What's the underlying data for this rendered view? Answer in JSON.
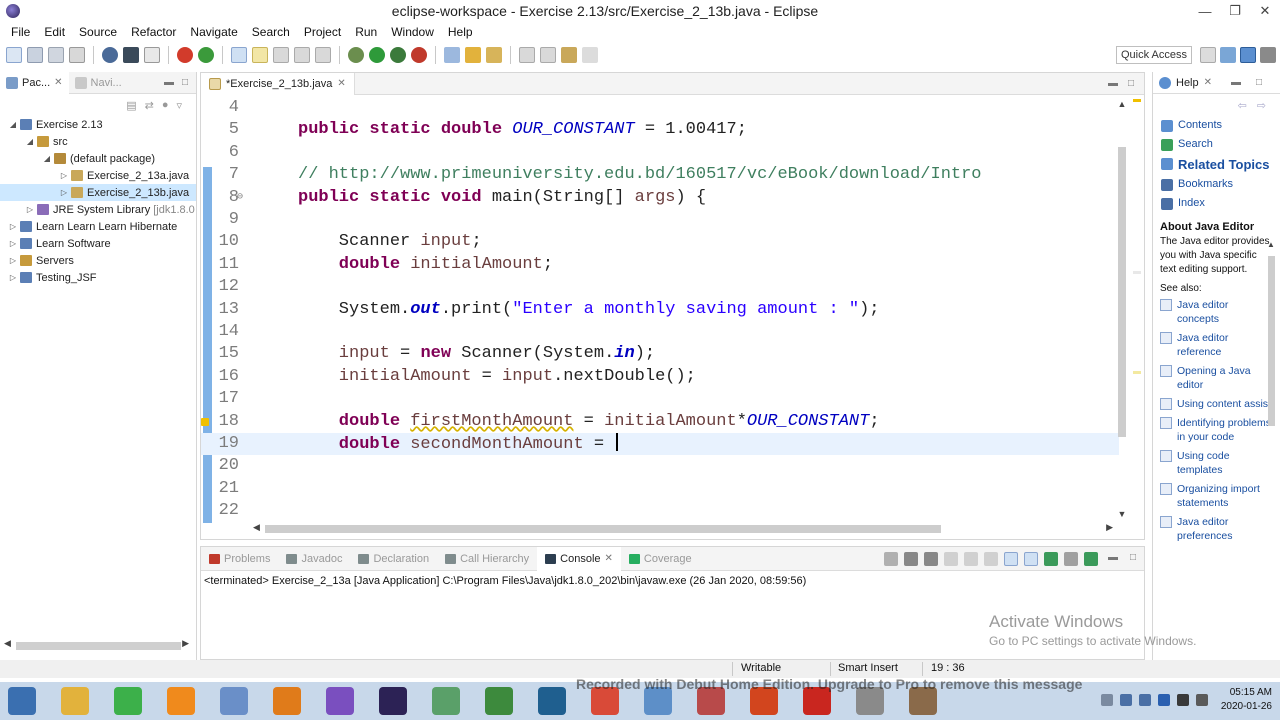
{
  "window": {
    "title": "eclipse-workspace - Exercise 2.13/src/Exercise_2_13b.java - Eclipse"
  },
  "menu": [
    "File",
    "Edit",
    "Source",
    "Refactor",
    "Navigate",
    "Search",
    "Project",
    "Run",
    "Window",
    "Help"
  ],
  "toolbar": {
    "quick_access": "Quick Access"
  },
  "left_view": {
    "tabs": [
      {
        "label": "Pac..."
      },
      {
        "label": "Navi..."
      }
    ],
    "tree": [
      {
        "label": "Exercise 2.13",
        "level": 0,
        "expanded": true,
        "icon": "project-icon",
        "color": "#5b7fb5"
      },
      {
        "label": "src",
        "level": 1,
        "expanded": true,
        "icon": "source-folder-icon",
        "color": "#c69a3c"
      },
      {
        "label": "(default package)",
        "level": 2,
        "expanded": true,
        "icon": "package-icon",
        "color": "#b48a3a"
      },
      {
        "label": "Exercise_2_13a.java",
        "level": 3,
        "expanded": false,
        "icon": "java-file-icon",
        "color": "#c9a85a"
      },
      {
        "label": "Exercise_2_13b.java",
        "level": 3,
        "expanded": false,
        "icon": "java-file-icon",
        "color": "#c9a85a",
        "selected": true
      },
      {
        "label": "JRE System Library",
        "decoration": "[jdk1.8.0",
        "level": 1,
        "expanded": false,
        "icon": "library-icon",
        "color": "#8a6cb8"
      },
      {
        "label": "Learn Learn Learn Hibernate",
        "level": 0,
        "expanded": false,
        "icon": "project-icon",
        "color": "#5b7fb5"
      },
      {
        "label": "Learn Software",
        "level": 0,
        "expanded": false,
        "icon": "project-icon",
        "color": "#5b7fb5"
      },
      {
        "label": "Servers",
        "level": 0,
        "expanded": false,
        "icon": "project-icon",
        "color": "#c69a3c"
      },
      {
        "label": "Testing_JSF",
        "level": 0,
        "expanded": false,
        "icon": "project-icon",
        "color": "#5b7fb5"
      }
    ]
  },
  "editor": {
    "tab_label": "*Exercise_2_13b.java",
    "lines": [
      {
        "num": "4",
        "tokens": []
      },
      {
        "num": "5",
        "tokens": [
          [
            "kw",
            "public static double "
          ],
          [
            "const",
            "OUR_CONSTANT"
          ],
          [
            "plain",
            " = 1.00417;"
          ]
        ]
      },
      {
        "num": "6",
        "tokens": []
      },
      {
        "num": "7",
        "tokens": [
          [
            "cmt",
            "// http://www.primeuniversity.edu.bd/160517/vc/eBook/download/Intro"
          ]
        ]
      },
      {
        "num": "8",
        "fold": true,
        "tokens": [
          [
            "kw",
            "public static void "
          ],
          [
            "plain",
            "main(String[] "
          ],
          [
            "var",
            "args"
          ],
          [
            "plain",
            ") {"
          ]
        ]
      },
      {
        "num": "9",
        "tokens": []
      },
      {
        "num": "10",
        "tokens": [
          [
            "plain",
            "    Scanner "
          ],
          [
            "var",
            "input"
          ],
          [
            "plain",
            ";"
          ]
        ]
      },
      {
        "num": "11",
        "tokens": [
          [
            "kw",
            "    double "
          ],
          [
            "var",
            "initialAmount"
          ],
          [
            "plain",
            ";"
          ]
        ]
      },
      {
        "num": "12",
        "tokens": []
      },
      {
        "num": "13",
        "tokens": [
          [
            "plain",
            "    System."
          ],
          [
            "fld",
            "out"
          ],
          [
            "plain",
            ".print("
          ],
          [
            "str",
            "\"Enter a monthly saving amount : \""
          ],
          [
            "plain",
            ");"
          ]
        ]
      },
      {
        "num": "14",
        "tokens": []
      },
      {
        "num": "15",
        "tokens": [
          [
            "var",
            "    input"
          ],
          [
            "plain",
            " = "
          ],
          [
            "kw",
            "new "
          ],
          [
            "plain",
            "Scanner(System."
          ],
          [
            "fld",
            "in"
          ],
          [
            "plain",
            ");"
          ]
        ]
      },
      {
        "num": "16",
        "tokens": [
          [
            "var",
            "    initialAmount"
          ],
          [
            "plain",
            " = "
          ],
          [
            "var",
            "input"
          ],
          [
            "plain",
            ".nextDouble();"
          ]
        ]
      },
      {
        "num": "17",
        "tokens": []
      },
      {
        "num": "18",
        "warning": true,
        "tokens": [
          [
            "kw",
            "    double "
          ],
          [
            "warnvar",
            "firstMonthAmount"
          ],
          [
            "plain",
            " = "
          ],
          [
            "var",
            "initialAmount"
          ],
          [
            "plain",
            "*"
          ],
          [
            "const",
            "OUR_CONSTANT"
          ],
          [
            "plain",
            ";"
          ]
        ]
      },
      {
        "num": "19",
        "current": true,
        "tokens": [
          [
            "kw",
            "    double "
          ],
          [
            "var",
            "secondMonthAmount"
          ],
          [
            "plain",
            " = "
          ],
          [
            "caret",
            ""
          ]
        ]
      },
      {
        "num": "20",
        "tokens": []
      },
      {
        "num": "21",
        "tokens": []
      },
      {
        "num": "22",
        "tokens": []
      }
    ]
  },
  "console": {
    "tabs": [
      {
        "label": "Problems",
        "active": false,
        "icon": "problems-icon",
        "color": "#c0392b"
      },
      {
        "label": "Javadoc",
        "active": false,
        "icon": "javadoc-icon",
        "color": "#7f8c8d"
      },
      {
        "label": "Declaration",
        "active": false,
        "icon": "declaration-icon",
        "color": "#7f8c8d"
      },
      {
        "label": "Call Hierarchy",
        "active": false,
        "icon": "call-hierarchy-icon",
        "color": "#7f8c8d"
      },
      {
        "label": "Console",
        "active": true,
        "icon": "console-icon",
        "color": "#2c3e50"
      },
      {
        "label": "Coverage",
        "active": false,
        "icon": "coverage-icon",
        "color": "#27ae60"
      }
    ],
    "output": "<terminated> Exercise_2_13a [Java Application] C:\\Program Files\\Java\\jdk1.8.0_202\\bin\\javaw.exe (26 Jan 2020, 08:59:56)"
  },
  "help": {
    "tab_label": "Help",
    "links": [
      {
        "label": "Contents",
        "big": false,
        "color": "#5b8fd0"
      },
      {
        "label": "Search",
        "big": false,
        "color": "#3aa05a"
      },
      {
        "label": "Related Topics",
        "big": true,
        "color": "#5b8fd0"
      },
      {
        "label": "Bookmarks",
        "big": false,
        "color": "#4a6fa5"
      },
      {
        "label": "Index",
        "big": false,
        "color": "#4a6fa5"
      }
    ],
    "about_title": "About Java Editor",
    "about_text": "The Java editor provides you with Java specific text editing support.",
    "see_also": "See also:",
    "see_links": [
      "Java editor concepts",
      "Java editor reference",
      "Opening a Java editor",
      "Using content assist",
      "Identifying problems in your code",
      "Using code templates",
      "Organizing import statements",
      "Java editor preferences"
    ]
  },
  "status": {
    "writable": "Writable",
    "insert_mode": "Smart Insert",
    "position": "19 : 36"
  },
  "overlay": {
    "activate_title": "Activate Windows",
    "activate_sub": "Go to PC settings to activate Windows.",
    "recorded": "Recorded with Debut Home Edition. Upgrade to Pro to remove this message"
  },
  "taskbar": {
    "apps": [
      {
        "name": "start-icon",
        "color": "#3a6fb0"
      },
      {
        "name": "file-explorer-icon",
        "color": "#e2b23c"
      },
      {
        "name": "spotify-icon",
        "color": "#3cb04a"
      },
      {
        "name": "vlc-icon",
        "color": "#f08a1c"
      },
      {
        "name": "word-icon",
        "color": "#6a8fc8"
      },
      {
        "name": "media-player-icon",
        "color": "#e07b1a"
      },
      {
        "name": "visual-studio-icon",
        "color": "#7a4fbf"
      },
      {
        "name": "eclipse-icon",
        "color": "#2c2255"
      },
      {
        "name": "android-studio-icon",
        "color": "#5aa069"
      },
      {
        "name": "notepad-icon",
        "color": "#3d8a3d"
      },
      {
        "name": "snipping-tool-icon",
        "color": "#1f5f8f"
      },
      {
        "name": "chrome-icon",
        "color": "#d94a38"
      },
      {
        "name": "disk-icon",
        "color": "#5d8fc8"
      },
      {
        "name": "recorder-icon",
        "color": "#b84a4a"
      },
      {
        "name": "office-icon",
        "color": "#d2451e"
      },
      {
        "name": "acrobat-icon",
        "color": "#c9261f"
      },
      {
        "name": "settings-icon",
        "color": "#8a8a8a"
      },
      {
        "name": "debut-icon",
        "color": "#8a6a4a"
      }
    ],
    "time": "05:15 AM",
    "date": "2020-01-26"
  }
}
